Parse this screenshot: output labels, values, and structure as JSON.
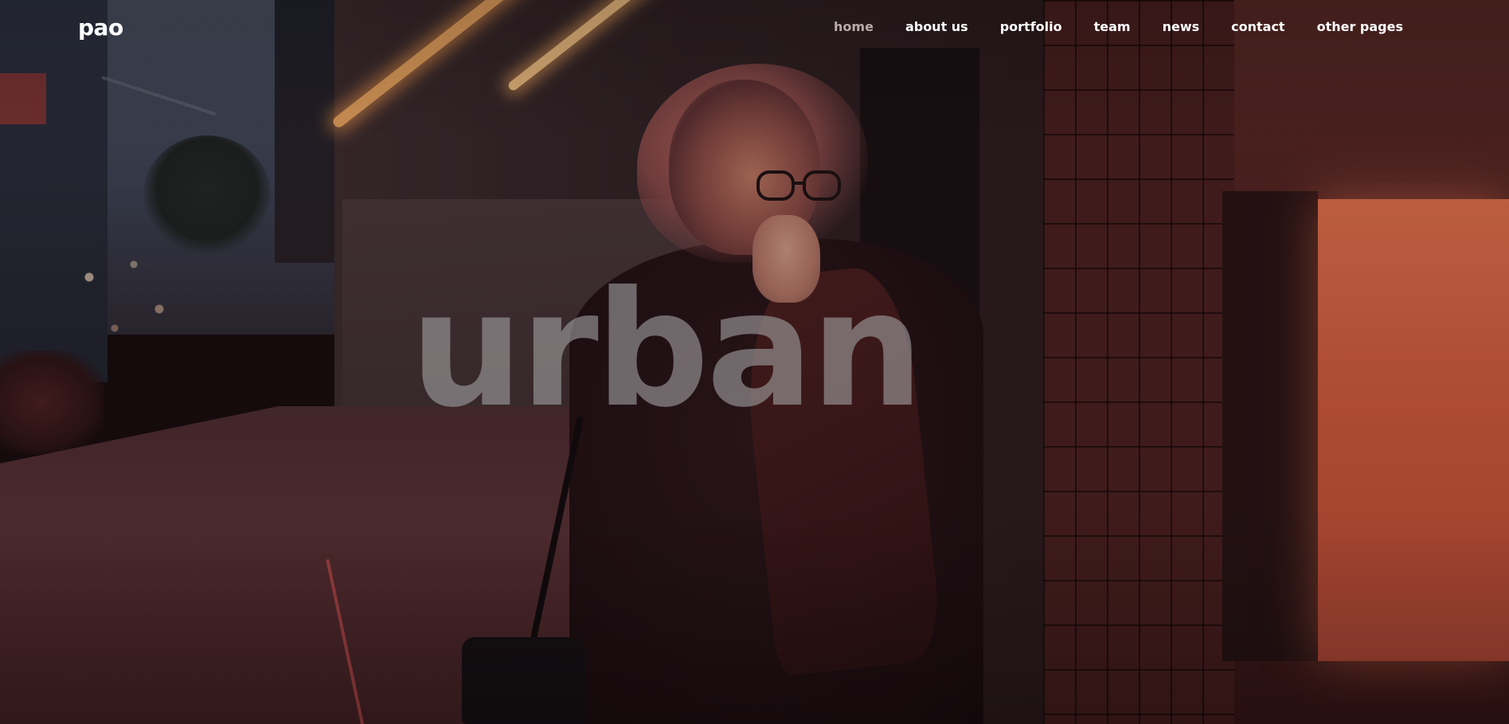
{
  "brand": {
    "logo_text": "pao"
  },
  "nav": {
    "items": [
      {
        "label": "home",
        "active": true
      },
      {
        "label": "about us",
        "active": false
      },
      {
        "label": "portfolio",
        "active": false
      },
      {
        "label": "team",
        "active": false
      },
      {
        "label": "news",
        "active": false
      },
      {
        "label": "contact",
        "active": false
      },
      {
        "label": "other pages",
        "active": false
      }
    ],
    "active_color": "#b9aca8",
    "text_color": "#ffffff"
  },
  "hero": {
    "title": "urban",
    "image_description_colors": {
      "neon_orange": "#f6b064",
      "tile_red": "#4a1f1e",
      "panel_glow": "#e8744d"
    }
  }
}
